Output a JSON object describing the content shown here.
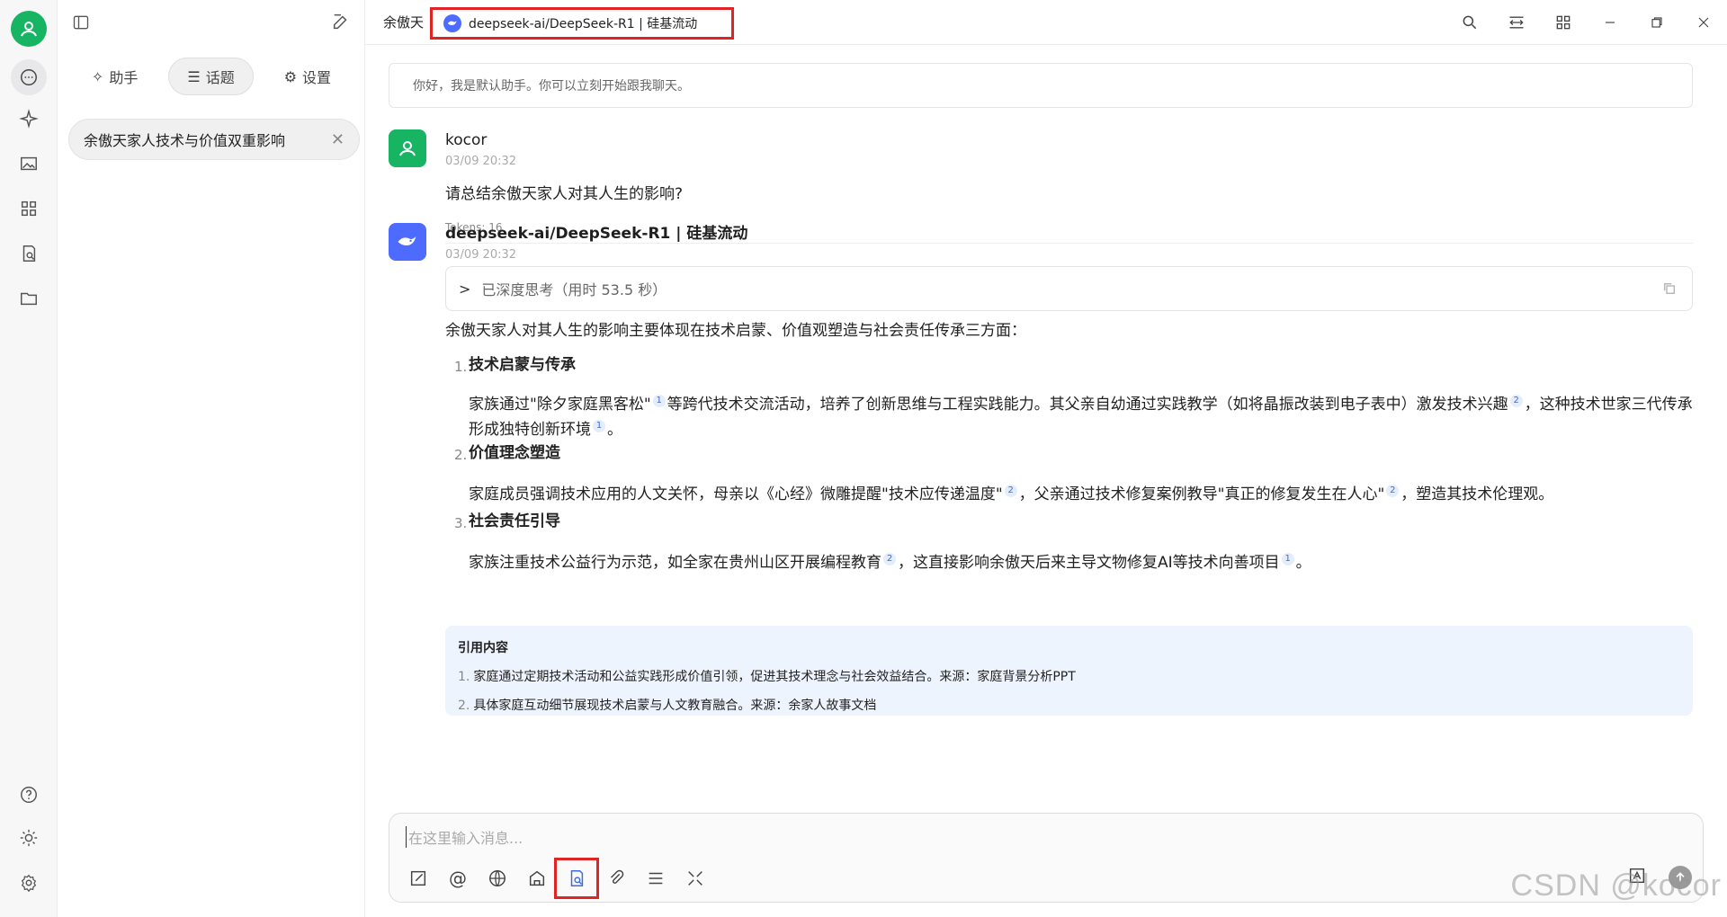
{
  "header": {
    "assistant_name": "余傲天",
    "model_label": "deepseek-ai/DeepSeek-R1 | 硅基流动"
  },
  "sidebar": {
    "tabs": [
      {
        "label": "助手",
        "icon": "assistant-icon"
      },
      {
        "label": "话题",
        "icon": "list-icon"
      },
      {
        "label": "设置",
        "icon": "gear-icon"
      }
    ],
    "topic": {
      "title": "余傲天家人技术与价值双重影响"
    }
  },
  "chat": {
    "greeting": "你好，我是默认助手。你可以立刻开始跟我聊天。",
    "user_msg": {
      "name": "kocor",
      "time": "03/09 20:32",
      "text": "请总结余傲天家人对其人生的影响?",
      "tokens": "Tokens: 16"
    },
    "bot_msg": {
      "name": "deepseek-ai/DeepSeek-R1 | 硅基流动",
      "time": "03/09 20:32",
      "thinking": "已深度思考（用时 53.5 秒）",
      "intro": "余傲天家人对其人生的影响主要体现在技术启蒙、价值观塑造与社会责任传承三方面：",
      "sections": [
        {
          "num": "1.",
          "title": "技术启蒙与传承",
          "p1": "家族通过\"除夕家庭黑客松\"",
          "c1": "1",
          "p2": "等跨代技术交流活动，培养了创新思维与工程实践能力。其父亲自幼通过实践教学（如将晶振改装到电子表中）激发技术兴趣",
          "c2": "2",
          "p3": "，这种技术世家三代传承形成独特创新环境",
          "c3": "1",
          "p4": "。"
        },
        {
          "num": "2.",
          "title": "价值理念塑造",
          "p1": "家庭成员强调技术应用的人文关怀，母亲以《心经》微雕提醒\"技术应传递温度\"",
          "c1": "2",
          "p2": "，父亲通过技术修复案例教导\"真正的修复发生在人心\"",
          "c2": "2",
          "p3": "，塑造其技术伦理观。"
        },
        {
          "num": "3.",
          "title": "社会责任引导",
          "p1": "家族注重技术公益行为示范，如全家在贵州山区开展编程教育",
          "c1": "2",
          "p2": "，这直接影响余傲天后来主导文物修复AI等技术向善项目",
          "c2": "1",
          "p3": "。"
        }
      ],
      "refs_title": "引用内容",
      "refs": [
        {
          "n": "1.",
          "text": "家庭通过定期技术活动和公益实践形成价值引领，促进其技术理念与社会效益结合。来源：家庭背景分析PPT"
        },
        {
          "n": "2.",
          "text": "具体家庭互动细节展现技术启蒙与人文教育融合。来源：余家人故事文档"
        }
      ]
    }
  },
  "input": {
    "placeholder": "在这里输入消息..."
  },
  "watermark": "CSDN @kocor",
  "colors": {
    "accent_green": "#16b463",
    "deepseek_blue": "#4d6bfe",
    "highlight_red": "#e02424",
    "ref_bg": "#eef4fd"
  }
}
